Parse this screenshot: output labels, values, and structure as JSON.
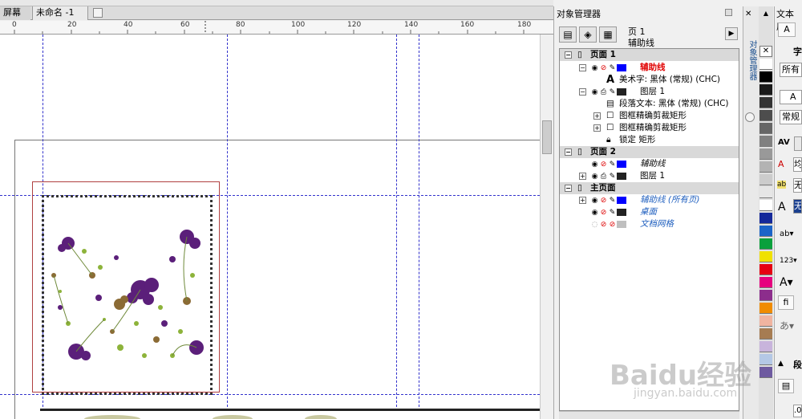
{
  "tabs": {
    "fullscreen": "屏幕",
    "doc": "未命名 -1"
  },
  "ruler": {
    "ticks": [
      "0",
      "20",
      "40",
      "60",
      "80",
      "100",
      "120",
      "140",
      "160",
      "180"
    ]
  },
  "docker": {
    "title": "对象管理器",
    "side_label": "对象管理器",
    "page_name": "页 1",
    "layer_name": "辅助线",
    "tree": [
      {
        "label": "页面 1",
        "type": "page"
      },
      {
        "label": "辅助线",
        "type": "layer",
        "color": "#0000ff",
        "style": "red"
      },
      {
        "label": "美术字: 黑体 (常规) (CHC)",
        "type": "object"
      },
      {
        "label": "图层 1",
        "type": "layer",
        "color": "#222222"
      },
      {
        "label": "段落文本: 黑体 (常规) (CHC)",
        "type": "object"
      },
      {
        "label": "图框精确剪裁矩形",
        "type": "object"
      },
      {
        "label": "图框精确剪裁矩形",
        "type": "object"
      },
      {
        "label": "锁定 矩形",
        "type": "object"
      },
      {
        "label": "页面 2",
        "type": "page"
      },
      {
        "label": "辅助线",
        "type": "layer",
        "color": "#0000ff",
        "style": "italic"
      },
      {
        "label": "图层 1",
        "type": "layer",
        "color": "#222222"
      },
      {
        "label": "主页面",
        "type": "page"
      },
      {
        "label": "辅助线 (所有页)",
        "type": "layer",
        "color": "#0000ff",
        "style": "blue"
      },
      {
        "label": "桌面",
        "type": "layer",
        "color": "#222222",
        "style": "blue"
      },
      {
        "label": "文档网格",
        "type": "layer",
        "color": "#bfbfbf",
        "style": "blue"
      }
    ]
  },
  "right_panel": {
    "title": "文本属",
    "font_label": "字",
    "font_value": "所有",
    "font_name": "A",
    "style_value": "常规",
    "item1": "均",
    "item2": "无",
    "item3": "无",
    "para_label": "段",
    "field_value": ".0"
  },
  "palette": [
    "#ffffff",
    "#000000",
    "#1a1a1a",
    "#333333",
    "#4d4d4d",
    "#666666",
    "#808080",
    "#999999",
    "#b3b3b3",
    "#cccccc",
    "#e6e6e6",
    "#ffffff",
    "#14289a",
    "#1b64c8",
    "#0aa03c",
    "#f0e100",
    "#e60012",
    "#e6007e",
    "#8c2d8c",
    "#f08c00",
    "#f0b4a0",
    "#a67c52",
    "#c8b4dc",
    "#b4c8e6",
    "#6e5aa0"
  ],
  "watermark": {
    "brand": "Baidu经验",
    "url": "jingyan.baidu.com"
  },
  "colors": {
    "guide": "#3333cc",
    "accent_red": "#e00000",
    "link_blue": "#1f5fbf"
  }
}
